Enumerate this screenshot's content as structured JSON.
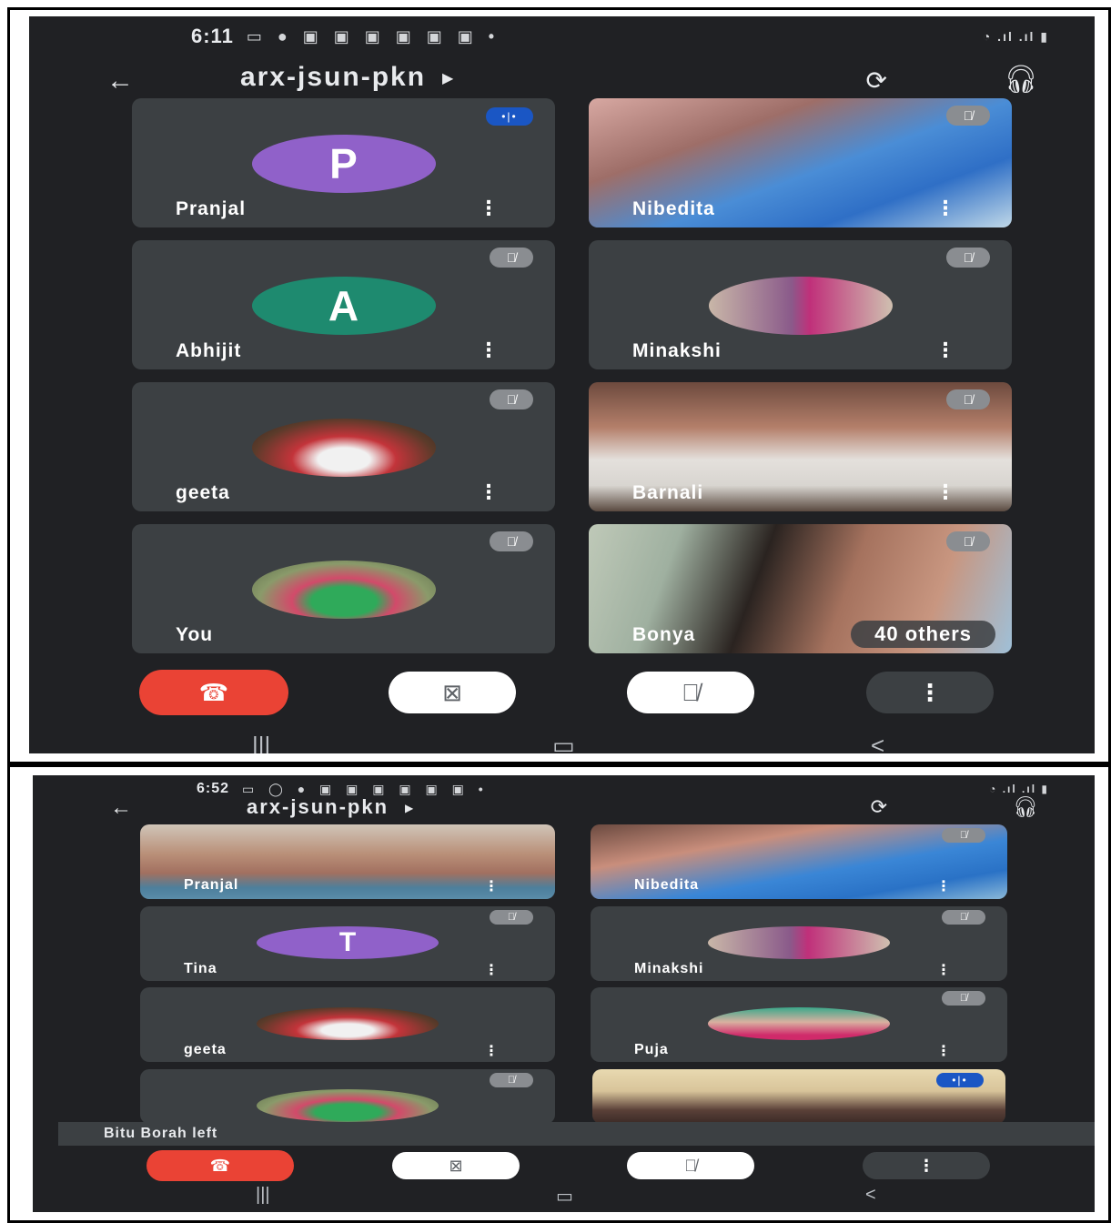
{
  "screens": [
    {
      "status_time": "6:11",
      "meeting_code": "arx-jsun-pkn",
      "participants": [
        {
          "name": "Pranjal",
          "avatar": "P",
          "avatar_color": "#9061c9",
          "speaking": true
        },
        {
          "name": "Nibedita",
          "muted": true,
          "video": true
        },
        {
          "name": "Abhijit",
          "avatar": "A",
          "avatar_color": "#1e8a6f",
          "muted": true
        },
        {
          "name": "Minakshi",
          "muted": true,
          "photo": true
        },
        {
          "name": "geeta",
          "muted": true,
          "photo": true
        },
        {
          "name": "Barnali",
          "muted": true,
          "video": true
        },
        {
          "name": "You",
          "muted": true,
          "photo": true
        },
        {
          "name": "Bonya",
          "muted": true,
          "video": true
        }
      ],
      "others_label": "40 others"
    },
    {
      "status_time": "6:52",
      "meeting_code": "arx-jsun-pkn",
      "participants": [
        {
          "name": "Pranjal",
          "video": true
        },
        {
          "name": "Nibedita",
          "muted": true,
          "video": true
        },
        {
          "name": "Tina",
          "avatar": "T",
          "avatar_color": "#9061c9",
          "muted": true
        },
        {
          "name": "Minakshi",
          "muted": true,
          "photo": true
        },
        {
          "name": "geeta",
          "muted": true,
          "photo": true
        },
        {
          "name": "Puja",
          "muted": true,
          "photo": true
        },
        {
          "name": "",
          "muted": true,
          "photo": true
        },
        {
          "name": "",
          "video": true,
          "speaking": true
        }
      ],
      "toast": "Bitu Borah left"
    }
  ],
  "controls": {
    "more": "⋮"
  },
  "icons": [
    "back-arrow-icon",
    "switch-camera-icon",
    "headphones-icon",
    "mic-off-icon",
    "end-call-icon",
    "camera-off-icon",
    "more-vert-icon"
  ]
}
